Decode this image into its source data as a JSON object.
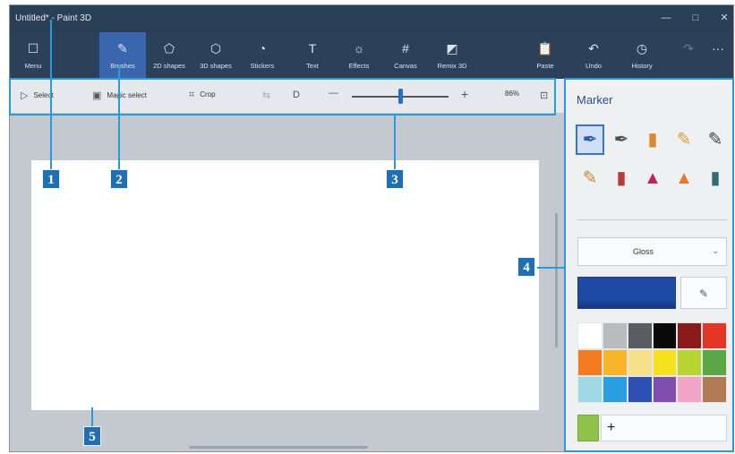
{
  "window": {
    "title": "Untitled* - Paint 3D",
    "minimize_glyph": "—",
    "maximize_glyph": "□",
    "close_glyph": "✕"
  },
  "ribbon": {
    "tools": [
      {
        "label": "Menu",
        "icon": "menu-icon",
        "glyph": "☐"
      },
      {
        "label": "Brushes",
        "icon": "brush-icon",
        "glyph": "✎"
      },
      {
        "label": "2D shapes",
        "icon": "2d-shapes-icon",
        "glyph": "⬠"
      },
      {
        "label": "3D shapes",
        "icon": "3d-shapes-icon",
        "glyph": "⬡"
      },
      {
        "label": "Stickers",
        "icon": "stickers-icon",
        "glyph": "◔"
      },
      {
        "label": "Text",
        "icon": "text-icon",
        "glyph": "T"
      },
      {
        "label": "Effects",
        "icon": "effects-icon",
        "glyph": "☼"
      },
      {
        "label": "Canvas",
        "icon": "canvas-icon",
        "glyph": "#"
      },
      {
        "label": "Remix 3D",
        "icon": "remix-3d-icon",
        "glyph": "◩"
      },
      {
        "label": "Paste",
        "icon": "paste-icon",
        "glyph": "📋"
      },
      {
        "label": "Undo",
        "icon": "undo-icon",
        "glyph": "↶"
      },
      {
        "label": "History",
        "icon": "history-icon",
        "glyph": "◷"
      }
    ],
    "redo_glyph": "↷",
    "more_glyph": "···",
    "active_tool": "Brushes"
  },
  "subbar": {
    "select_label": "Select",
    "select_glyph": "▷",
    "magic_select_label": "Magic select",
    "magic_select_glyph": "▣",
    "crop_label": "Crop",
    "crop_glyph": "⌗",
    "flip_glyph": "⇆",
    "view_3d_glyph": "D",
    "zoom_out_glyph": "—",
    "zoom_in_glyph": "+",
    "zoom_level": "86%",
    "zoom_fraction": 0.5,
    "fit_glyph": "⊡"
  },
  "panel": {
    "title": "Marker",
    "brushes": [
      {
        "name": "marker-brush-icon",
        "glyph": "✒",
        "color": "#2d5aa8",
        "selected": true
      },
      {
        "name": "calligraphy-pen-icon",
        "glyph": "✒",
        "color": "#4a4f57"
      },
      {
        "name": "oil-brush-icon",
        "glyph": "▮",
        "color": "#d98a2e"
      },
      {
        "name": "watercolor-icon",
        "glyph": "✎",
        "color": "#d9a03a"
      },
      {
        "name": "pixel-pen-icon",
        "glyph": "✎",
        "color": "#3d4552"
      },
      {
        "name": "pencil-icon",
        "glyph": "✎",
        "color": "#c98b3a"
      },
      {
        "name": "eraser-icon",
        "glyph": "▮",
        "color": "#b83a3a"
      },
      {
        "name": "crayon-icon",
        "glyph": "▲",
        "color": "#c0244f"
      },
      {
        "name": "spray-can-icon",
        "glyph": "▲",
        "color": "#e8772a"
      },
      {
        "name": "fill-icon",
        "glyph": "▮",
        "color": "#2f6f73"
      }
    ],
    "finish": "Gloss",
    "current_color": "#1e4aa6",
    "picker_glyph": "✎",
    "palette": [
      "#ffffff",
      "#b8bcbf",
      "#5a5e63",
      "#0a0a0a",
      "#8b1a1a",
      "#e53524",
      "#f47b20",
      "#f9b52a",
      "#f7e08a",
      "#f7e11c",
      "#b8d433",
      "#5aa845",
      "#9fd9e3",
      "#2a9ee0",
      "#2e4fb3",
      "#7f4cb0",
      "#f2a6c5",
      "#b07a52"
    ],
    "custom_color": "#8fc24a",
    "add_glyph": "+"
  },
  "callouts": [
    "1",
    "2",
    "3",
    "4",
    "5"
  ]
}
